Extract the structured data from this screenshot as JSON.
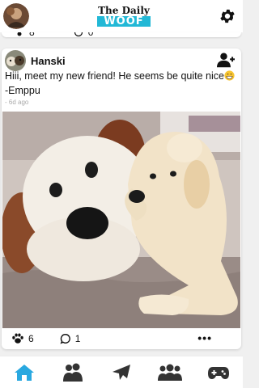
{
  "header": {
    "logo_top": "The Daily",
    "logo_bottom": "WOOF"
  },
  "previous_post": {
    "paw_count": "8",
    "comment_count": "0"
  },
  "post": {
    "username": "Hanski",
    "caption": "Hiii, meet my new friend! He seems be quite nice",
    "caption_suffix": " -Emppu",
    "timestamp": "- 6d ago",
    "paw_count": "6",
    "comment_count": "1",
    "more_label": "•••"
  },
  "nav": {
    "items": [
      "home-icon",
      "profile-icon",
      "send-icon",
      "friends-icon",
      "game-icon"
    ],
    "active": "home-icon"
  },
  "colors": {
    "accent": "#22b8d6",
    "nav_active": "#29a8e0",
    "nav_inactive": "#333333"
  }
}
